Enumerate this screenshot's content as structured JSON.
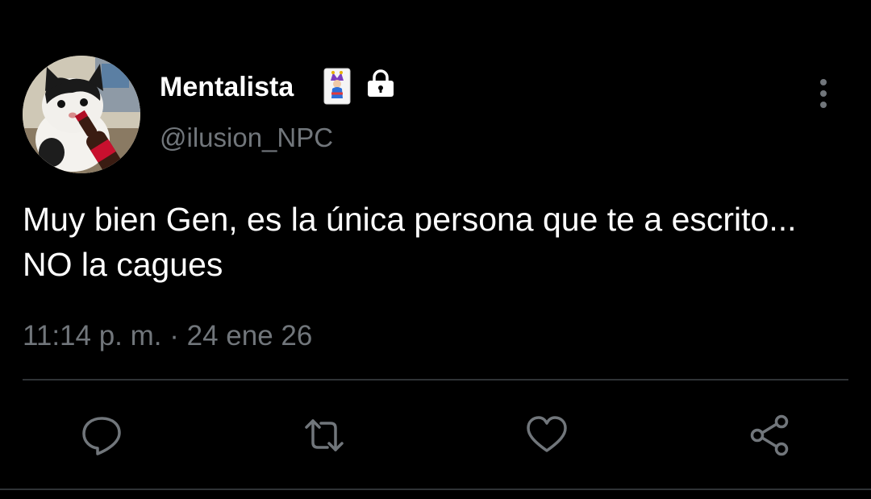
{
  "author": {
    "display_name": "Mentalista",
    "handle": "@ilusion_NPC",
    "badge_icon": "joker-card-icon",
    "protected_icon": "lock-icon"
  },
  "tweet": {
    "text": "Muy bien Gen, es la única persona que te a escrito... NO la cagues",
    "timestamp": "11:14 p. m. · 24 ene 26"
  },
  "actions": {
    "reply_icon": "reply-icon",
    "retweet_icon": "retweet-icon",
    "like_icon": "heart-icon",
    "share_icon": "share-icon"
  },
  "colors": {
    "background": "#000000",
    "primary_text": "#ffffff",
    "secondary_text": "#71767b",
    "icon": "#71767b",
    "divider": "#2f3336"
  }
}
